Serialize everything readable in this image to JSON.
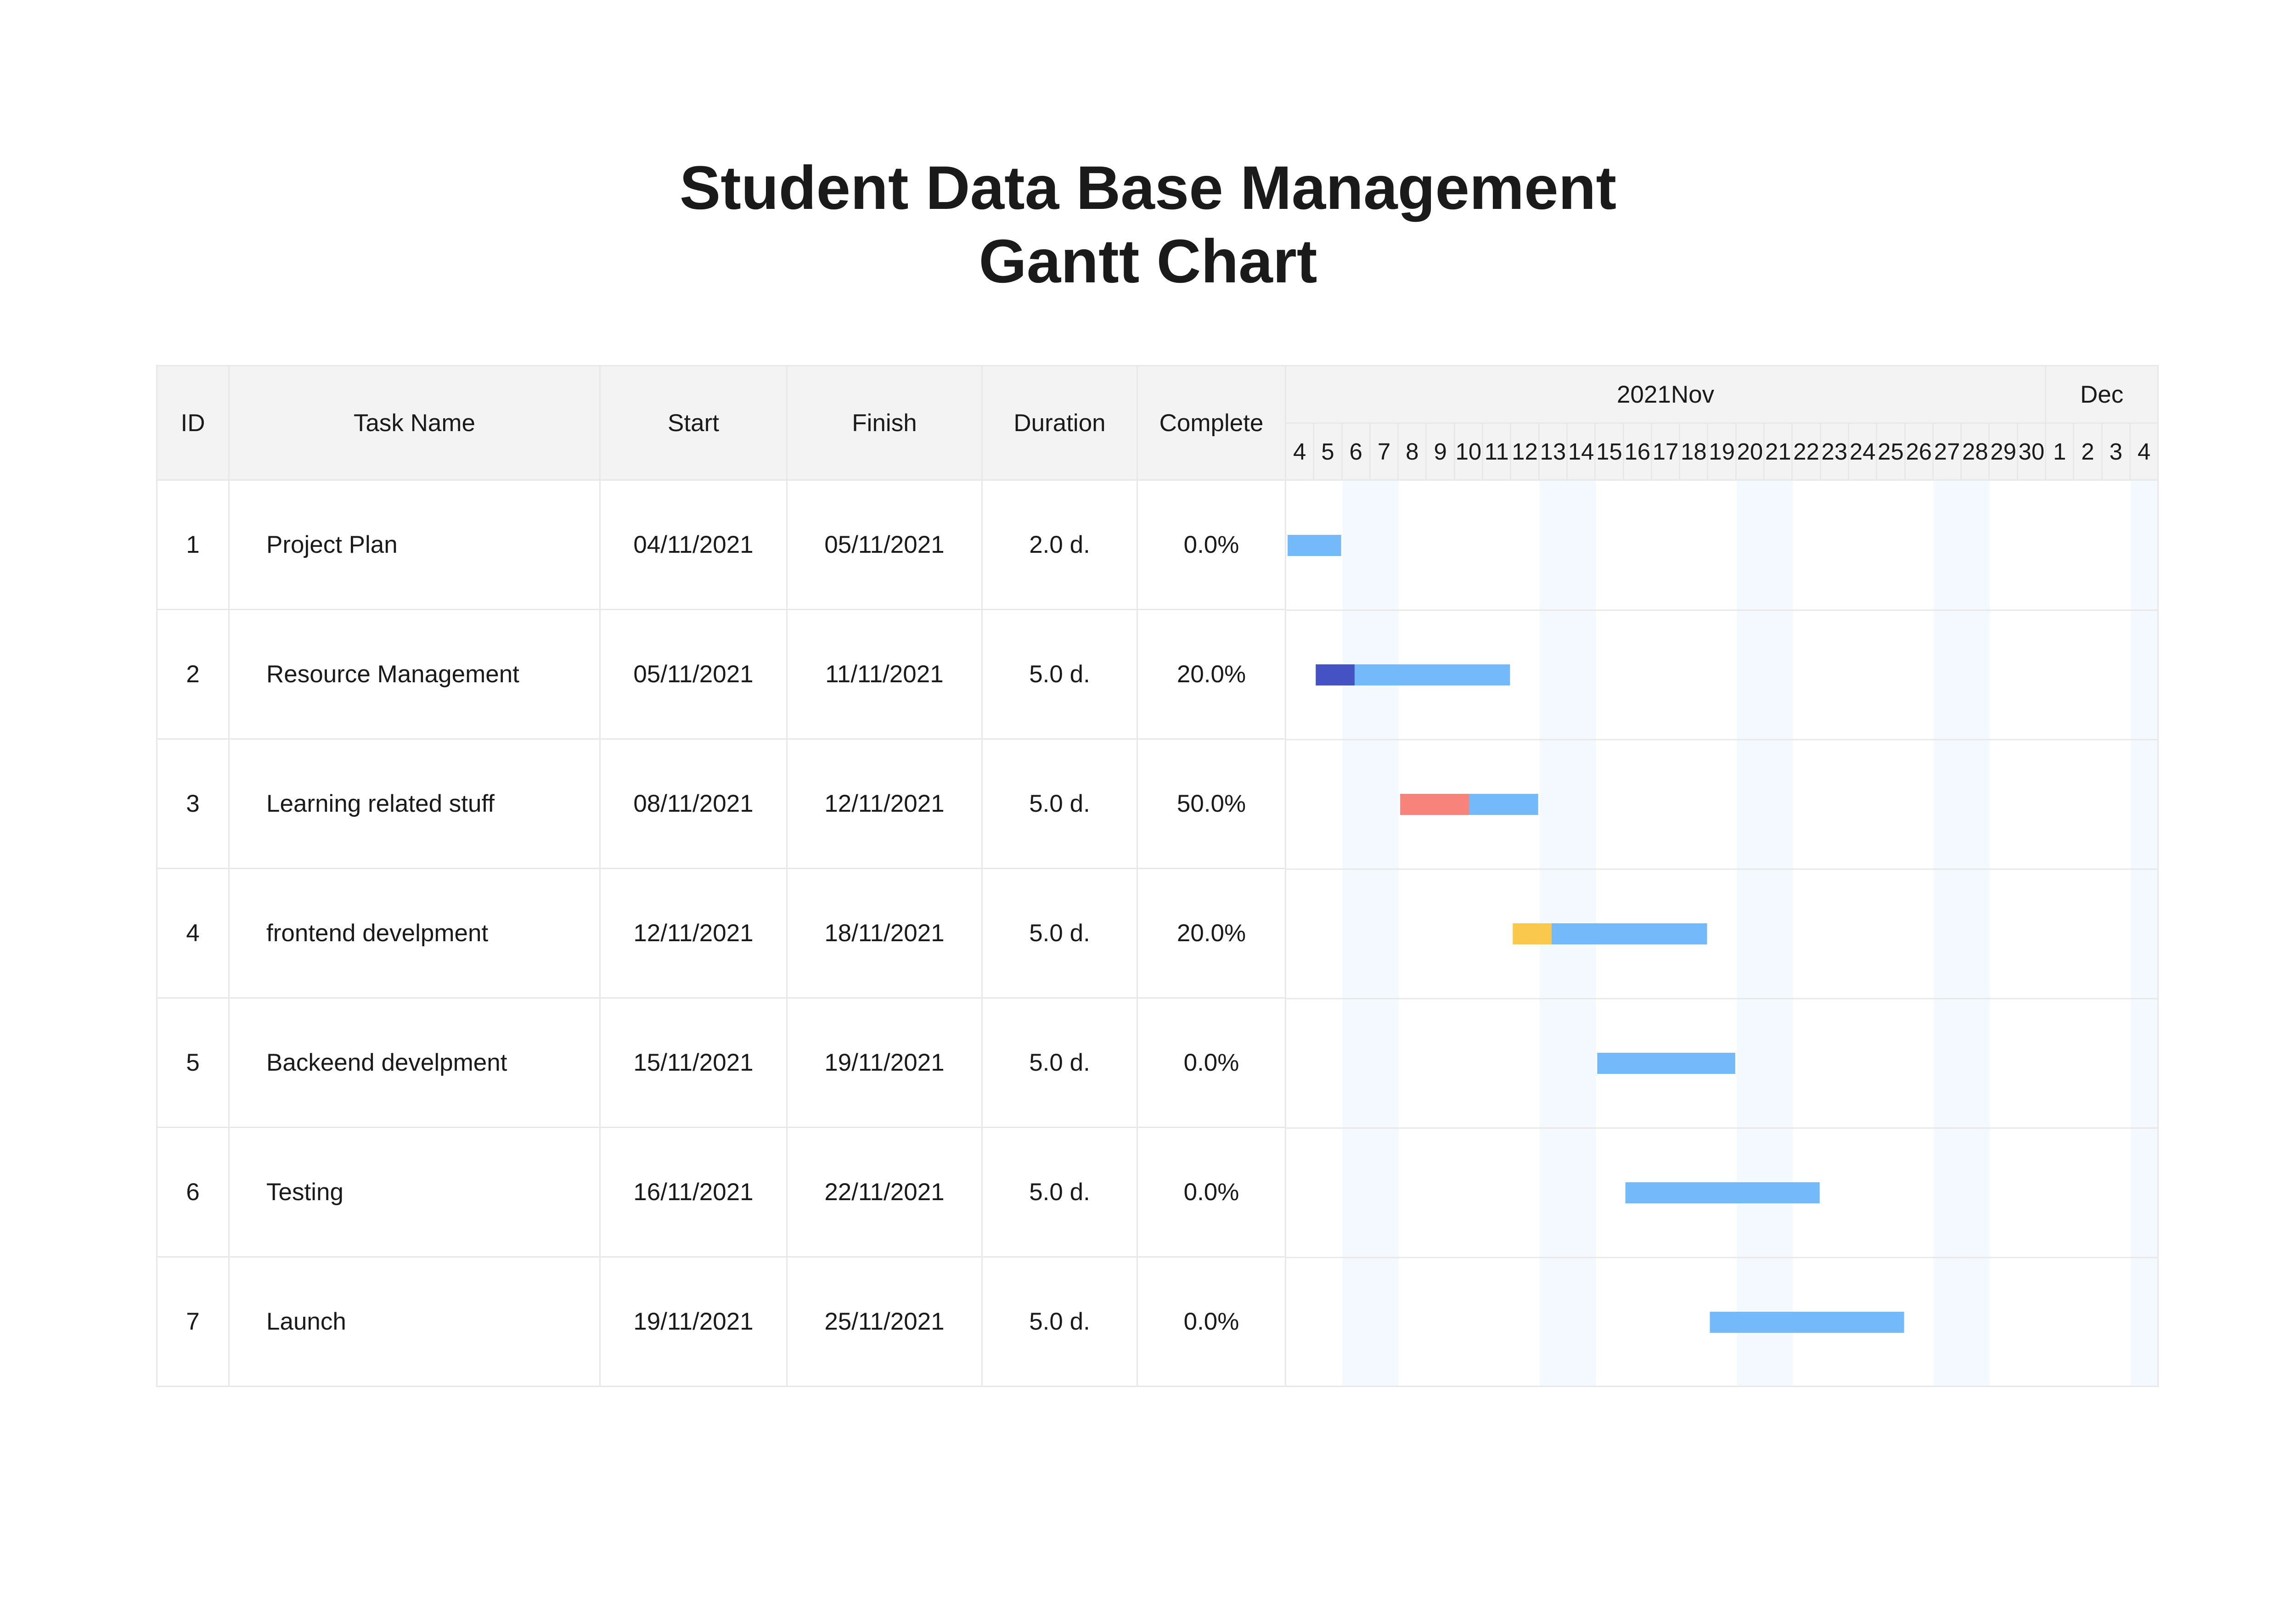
{
  "title": {
    "line1": "Student Data Base Management",
    "line2": "Gantt Chart"
  },
  "columns": {
    "id": "ID",
    "task": "Task Name",
    "start": "Start",
    "finish": "Finish",
    "duration": "Duration",
    "complete": "Complete"
  },
  "timeline": {
    "months": [
      {
        "label": "2021Nov",
        "days": [
          "4",
          "5",
          "6",
          "7",
          "8",
          "9",
          "10",
          "11",
          "12",
          "13",
          "14",
          "15",
          "16",
          "17",
          "18",
          "19",
          "20",
          "21",
          "22",
          "23",
          "24",
          "25",
          "26",
          "27",
          "28",
          "29",
          "30"
        ]
      },
      {
        "label": "Dec",
        "days": [
          "1",
          "2",
          "3",
          "4"
        ]
      }
    ],
    "weekend_indices": [
      2,
      3,
      9,
      10,
      16,
      17,
      23,
      24,
      30
    ]
  },
  "colors": {
    "bar": "#74b9fa",
    "weekend": "#f4f9ff",
    "grid": "#e8e8e8",
    "header_bg": "#f3f3f3"
  },
  "tasks": [
    {
      "id": "1",
      "name": "Project Plan",
      "start": "04/11/2021",
      "finish": "05/11/2021",
      "duration": "2.0 d.",
      "complete": "0.0%"
    },
    {
      "id": "2",
      "name": "Resource Management",
      "start": "05/11/2021",
      "finish": "11/11/2021",
      "duration": "5.0 d.",
      "complete": "20.0%"
    },
    {
      "id": "3",
      "name": "Learning related stuff",
      "start": "08/11/2021",
      "finish": "12/11/2021",
      "duration": "5.0 d.",
      "complete": "50.0%"
    },
    {
      "id": "4",
      "name": "frontend develpment",
      "start": "12/11/2021",
      "finish": "18/11/2021",
      "duration": "5.0 d.",
      "complete": "20.0%"
    },
    {
      "id": "5",
      "name": "Backeend develpment",
      "start": "15/11/2021",
      "finish": "19/11/2021",
      "duration": "5.0 d.",
      "complete": "0.0%"
    },
    {
      "id": "6",
      "name": "Testing",
      "start": "16/11/2021",
      "finish": "22/11/2021",
      "duration": "5.0 d.",
      "complete": "0.0%"
    },
    {
      "id": "7",
      "name": "Launch",
      "start": "19/11/2021",
      "finish": "25/11/2021",
      "duration": "5.0 d.",
      "complete": "0.0%"
    }
  ],
  "chart_data": {
    "type": "gantt",
    "title": "Student Data Base Management Gantt Chart",
    "x_axis": {
      "type": "date",
      "start": "2021-11-04",
      "end": "2021-12-04"
    },
    "tasks": [
      {
        "id": 1,
        "name": "Project Plan",
        "start": "2021-11-04",
        "finish": "2021-11-05",
        "duration_days": 2.0,
        "complete": 0.0,
        "progress_color": "#74b9fa"
      },
      {
        "id": 2,
        "name": "Resource Management",
        "start": "2021-11-05",
        "finish": "2021-11-11",
        "duration_days": 5.0,
        "complete": 0.2,
        "progress_color": "#4452c4"
      },
      {
        "id": 3,
        "name": "Learning related stuff",
        "start": "2021-11-08",
        "finish": "2021-11-12",
        "duration_days": 5.0,
        "complete": 0.5,
        "progress_color": "#f7837b"
      },
      {
        "id": 4,
        "name": "frontend develpment",
        "start": "2021-11-12",
        "finish": "2021-11-18",
        "duration_days": 5.0,
        "complete": 0.2,
        "progress_color": "#fbc84e"
      },
      {
        "id": 5,
        "name": "Backeend develpment",
        "start": "2021-11-15",
        "finish": "2021-11-19",
        "duration_days": 5.0,
        "complete": 0.0,
        "progress_color": "#74b9fa"
      },
      {
        "id": 6,
        "name": "Testing",
        "start": "2021-11-16",
        "finish": "2021-11-22",
        "duration_days": 5.0,
        "complete": 0.0,
        "progress_color": "#74b9fa"
      },
      {
        "id": 7,
        "name": "Launch",
        "start": "2021-11-19",
        "finish": "2021-11-25",
        "duration_days": 5.0,
        "complete": 0.0,
        "progress_color": "#74b9fa"
      }
    ]
  }
}
